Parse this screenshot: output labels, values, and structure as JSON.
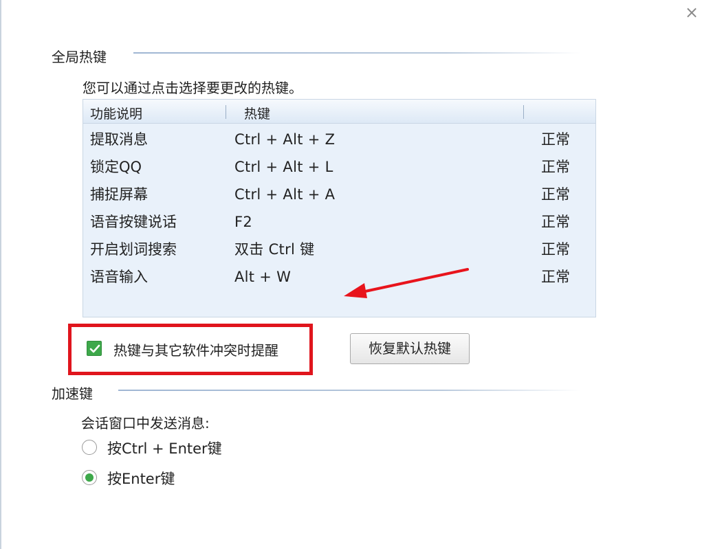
{
  "window": {
    "close_icon": "×"
  },
  "global_hotkeys": {
    "title": "全局热键",
    "description": "您可以通过点击选择要更改的热键。",
    "columns": [
      "功能说明",
      "热键"
    ],
    "rows": [
      {
        "function": "提取消息",
        "hotkey": "Ctrl + Alt + Z",
        "status": "正常"
      },
      {
        "function": "锁定QQ",
        "hotkey": "Ctrl + Alt + L",
        "status": "正常"
      },
      {
        "function": "捕捉屏幕",
        "hotkey": "Ctrl + Alt + A",
        "status": "正常"
      },
      {
        "function": "语音按键说话",
        "hotkey": "F2",
        "status": "正常"
      },
      {
        "function": "开启划词搜索",
        "hotkey": "双击 Ctrl 键",
        "status": "正常"
      },
      {
        "function": "语音输入",
        "hotkey": "Alt + W",
        "status": "正常"
      }
    ],
    "conflict_reminder": {
      "label": "热键与其它软件冲突时提醒",
      "checked": true
    },
    "restore_button": "恢复默认热键"
  },
  "accelerator": {
    "title": "加速键",
    "subtitle": "会话窗口中发送消息:",
    "options": [
      {
        "label": "按Ctrl + Enter键",
        "selected": false
      },
      {
        "label": "按Enter键",
        "selected": true
      }
    ]
  },
  "colors": {
    "highlight_border": "#e0151d",
    "annotation_arrow": "#e8141c",
    "accent_green": "#3da84a",
    "list_background": "#e9f1fa"
  }
}
